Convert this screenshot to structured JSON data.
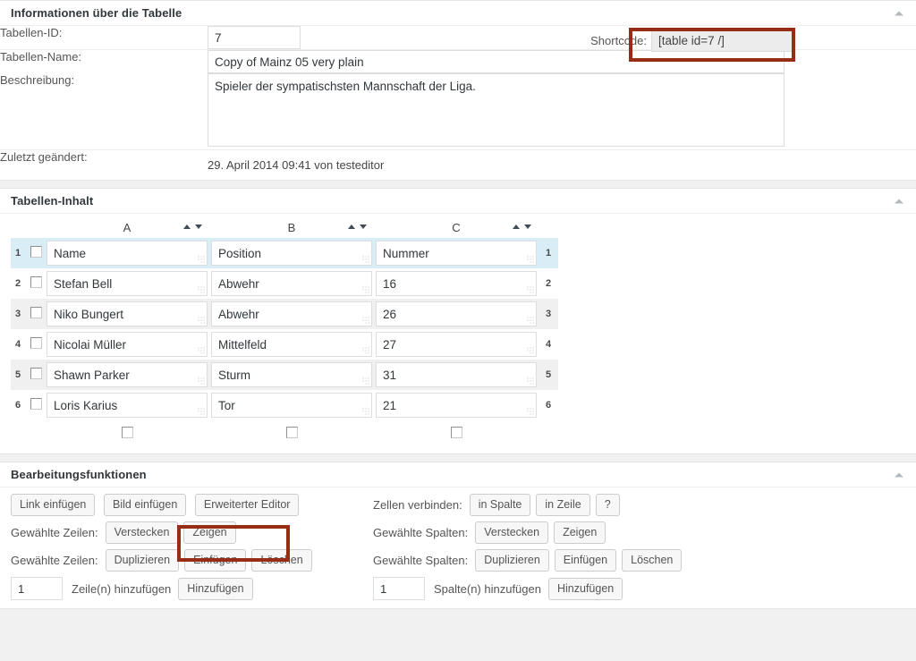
{
  "sections": {
    "info": {
      "title": "Informationen über die Tabelle",
      "toggle_icon": "collapse-triangle-icon",
      "fields": {
        "id_label": "Tabellen-ID:",
        "id_value": "7",
        "name_label": "Tabellen-Name:",
        "name_value": "Copy of Mainz 05 very plain",
        "description_label": "Beschreibung:",
        "description_value": "Spieler der sympatischsten Mannschaft der Liga.",
        "lastmod_label": "Zuletzt geändert:",
        "lastmod_value": "29. April 2014 09:41 von testeditor",
        "shortcode_label": "Shortcode:",
        "shortcode_value": "[table id=7 /]"
      }
    },
    "content": {
      "title": "Tabellen-Inhalt",
      "toggle_icon": "collapse-triangle-icon",
      "columns": [
        "A",
        "B",
        "C"
      ],
      "rows": [
        {
          "num": "1",
          "cells": [
            "Name",
            "Position",
            "Nummer"
          ]
        },
        {
          "num": "2",
          "cells": [
            "Stefan Bell",
            "Abwehr",
            "16"
          ]
        },
        {
          "num": "3",
          "cells": [
            "Niko Bungert",
            "Abwehr",
            "26"
          ]
        },
        {
          "num": "4",
          "cells": [
            "Nicolai Müller",
            "Mittelfeld",
            "27"
          ]
        },
        {
          "num": "5",
          "cells": [
            "Shawn Parker",
            "Sturm",
            "31"
          ]
        },
        {
          "num": "6",
          "cells": [
            "Loris Karius",
            "Tor",
            "21"
          ]
        }
      ]
    },
    "edit": {
      "title": "Bearbeitungsfunktionen",
      "toggle_icon": "collapse-triangle-icon",
      "insert_link": "Link einfügen",
      "insert_image": "Bild einfügen",
      "advanced_editor": "Erweiterter Editor",
      "merge_label": "Zellen verbinden:",
      "merge_in_column": "in Spalte",
      "merge_in_row": "in Zeile",
      "merge_help": "?",
      "rows_label_1": "Gewählte Zeilen:",
      "rows_hide": "Verstecken",
      "rows_show": "Zeigen",
      "rows_label_2": "Gewählte Zeilen:",
      "rows_duplicate": "Duplizieren",
      "rows_insert": "Einfügen",
      "rows_delete": "Löschen",
      "cols_label_1": "Gewählte Spalten:",
      "cols_hide": "Verstecken",
      "cols_show": "Zeigen",
      "cols_label_2": "Gewählte Spalten:",
      "cols_duplicate": "Duplizieren",
      "cols_insert": "Einfügen",
      "cols_delete": "Löschen",
      "add_rows_value": "1",
      "add_rows_label": "Zeile(n) hinzufügen",
      "add_rows_button": "Hinzufügen",
      "add_cols_value": "1",
      "add_cols_label": "Spalte(n) hinzufügen",
      "add_cols_button": "Hinzufügen"
    }
  },
  "highlights": {
    "color": "#962d14",
    "targets": [
      "shortcode-field",
      "advanced-editor-button"
    ]
  },
  "colors": {
    "page_background": "#f1f1f1",
    "panel_background": "#ffffff",
    "header_row_highlight": "#d9edf7",
    "alt_row": "#f0f0f0",
    "border": "#e5e5e5"
  }
}
